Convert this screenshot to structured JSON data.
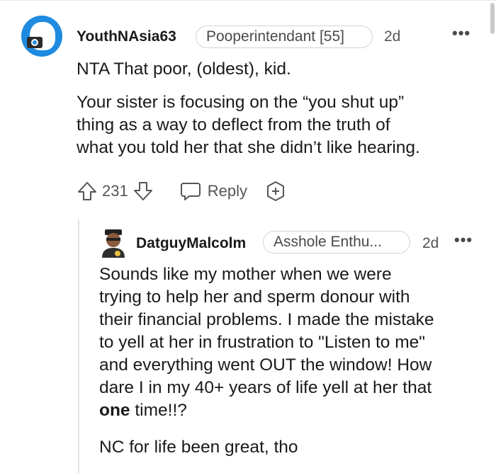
{
  "comment1": {
    "username": "YouthNAsia63",
    "flair": "Pooperintendant [55]",
    "time": "2d",
    "more_icon": "more-dots-icon",
    "paragraphs": [
      "NTA That poor, (oldest), kid.",
      "Your sister is focusing on the “you shut up”",
      "thing as a way to deflect from the truth of",
      "what you told her that she didn’t like hearing."
    ],
    "votes": "231",
    "reply_label": "Reply",
    "icons": [
      "upvote-icon",
      "downvote-icon",
      "reply-icon",
      "award-icon"
    ]
  },
  "comment2": {
    "username": "DatguyMalcolm",
    "flair": "Asshole Enthu...",
    "time": "2d",
    "lines": [
      "Sounds like my mother when we were",
      "trying to help her and sperm donour with",
      "their financial problems. I made the mistake",
      "to yell at her in frustration to \"Listen to me\"",
      "and everything went OUT the window! How",
      "dare I in my 40+ years of life yell at her that"
    ],
    "last_line_bold": "one",
    "last_line_rest": " time!!?",
    "closing": "NC for life been great, tho"
  },
  "colors": {
    "accent": "#1f8be0",
    "muted": "#555555",
    "border": "#d4d4d4"
  }
}
